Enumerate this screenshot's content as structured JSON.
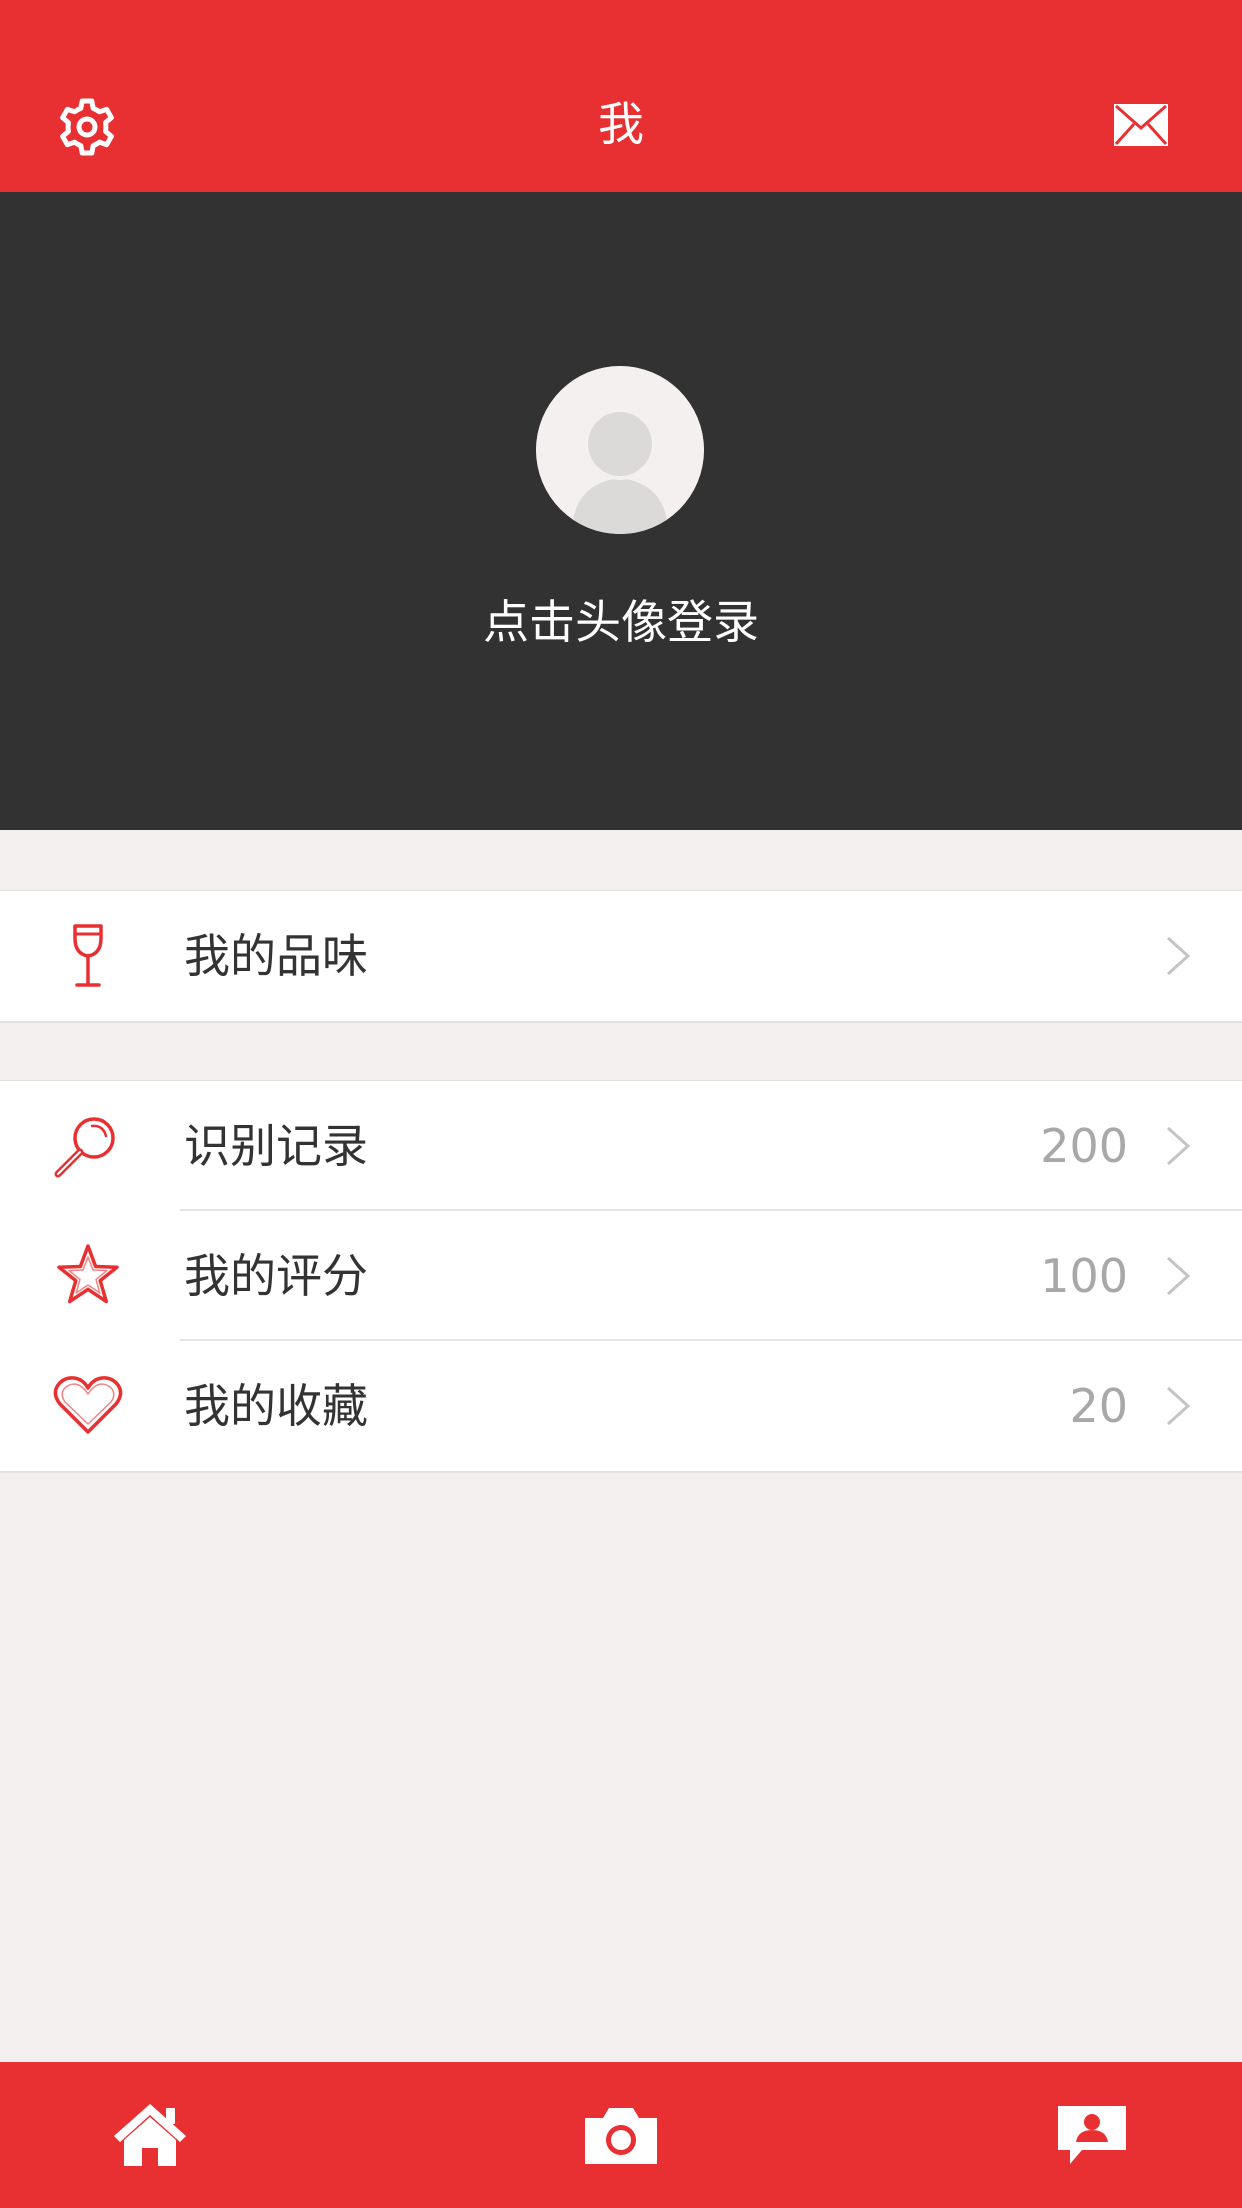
{
  "header": {
    "title": "我",
    "left_icon": "gear-icon",
    "right_icon": "mail-icon"
  },
  "profile": {
    "avatar_icon": "avatar-placeholder-icon",
    "login_prompt": "点击头像登录"
  },
  "groups": [
    {
      "items": [
        {
          "icon": "wine-glass-icon",
          "label": "我的品味",
          "count": ""
        }
      ]
    },
    {
      "items": [
        {
          "icon": "magnifier-icon",
          "label": "识别记录",
          "count": "200"
        },
        {
          "icon": "star-icon",
          "label": "我的评分",
          "count": "100"
        },
        {
          "icon": "heart-icon",
          "label": "我的收藏",
          "count": "20"
        }
      ]
    }
  ],
  "tabbar": {
    "tabs": [
      {
        "icon": "home-icon"
      },
      {
        "icon": "camera-icon"
      },
      {
        "icon": "profile-chat-icon"
      }
    ]
  },
  "colors": {
    "brand_red": "#e83032",
    "header_dark": "#323232",
    "page_background": "#f4efef",
    "count_gray": "#a8a8a8"
  }
}
